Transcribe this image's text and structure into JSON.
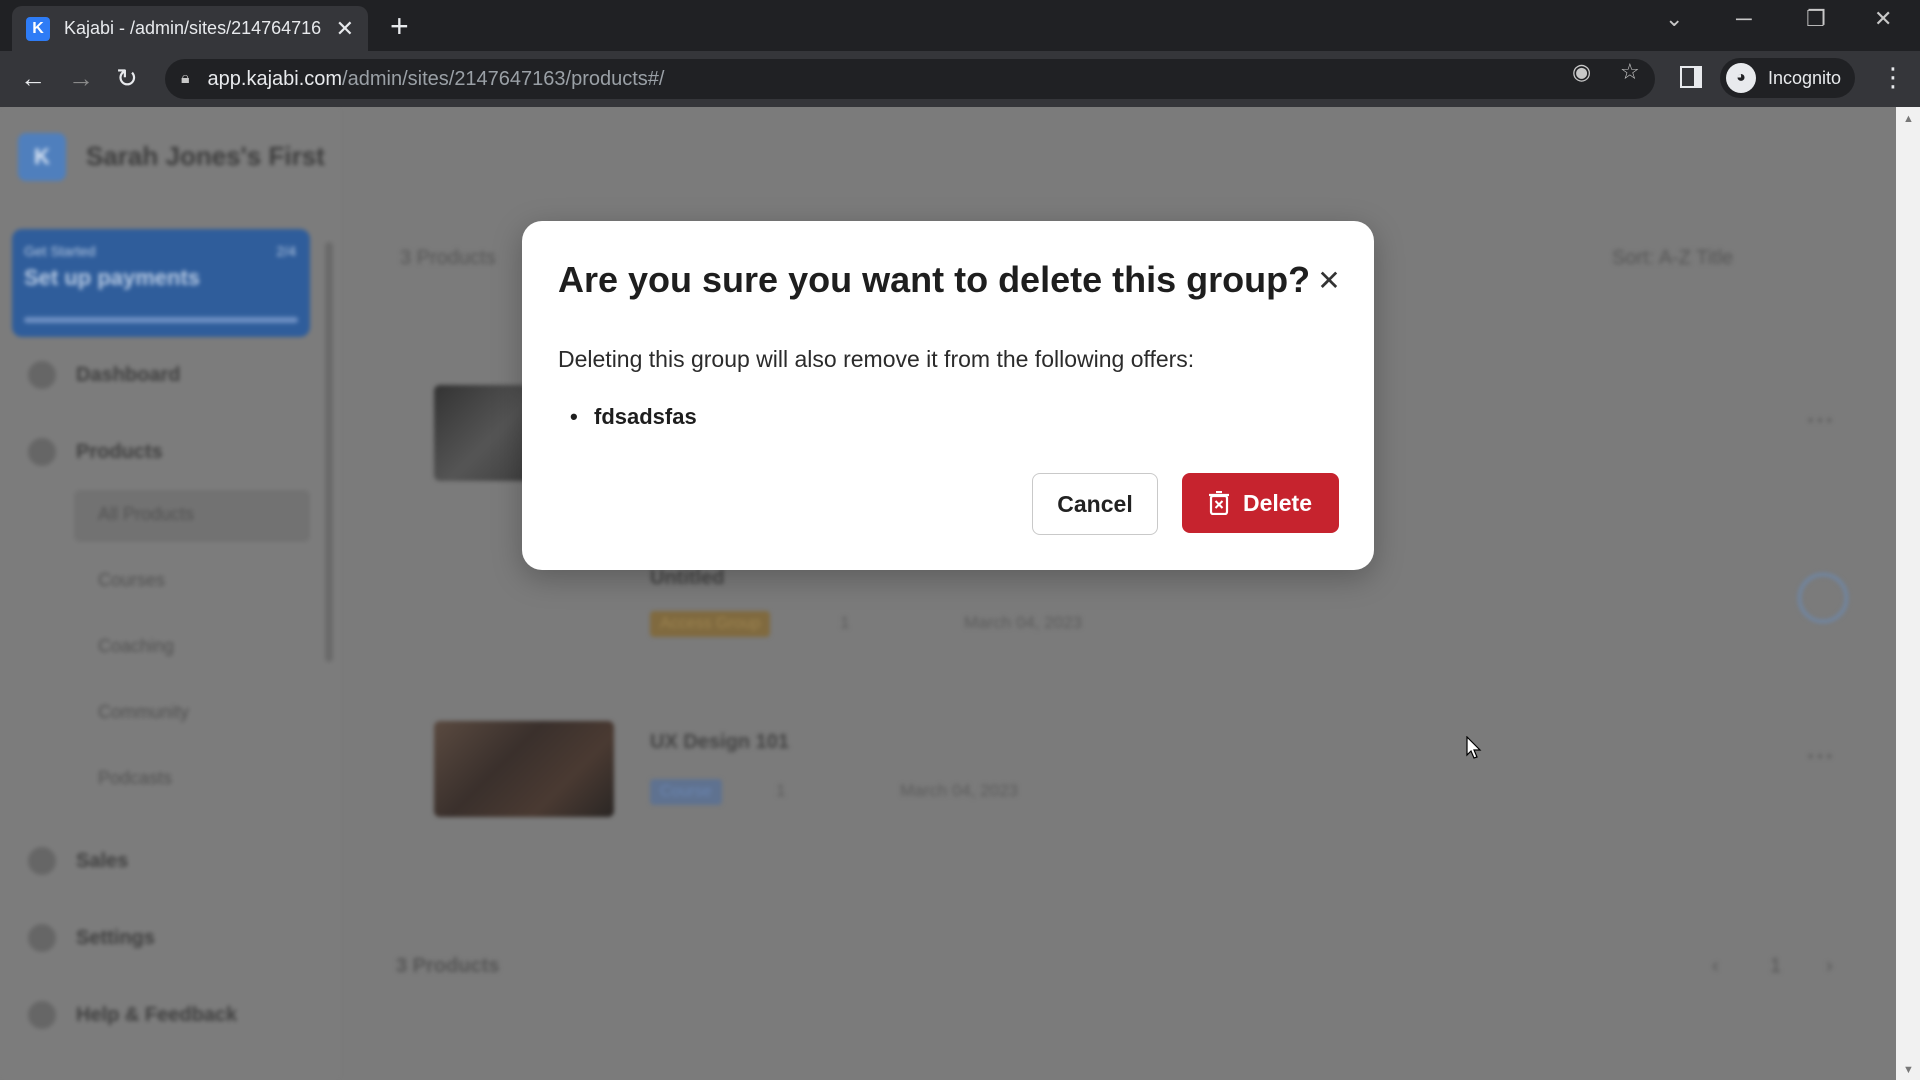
{
  "browser": {
    "tab_title": "Kajabi - /admin/sites/214764716",
    "favicon_letter": "K",
    "url_host": "app.kajabi.com",
    "url_path": "/admin/sites/2147647163/products#/",
    "profile_label": "Incognito"
  },
  "sidebar": {
    "logo_letter": "K",
    "site_name": "Sarah Jones's First",
    "promo": {
      "kicker": "Get Started",
      "title": "Set up payments",
      "count": "2/4"
    },
    "items": [
      {
        "label": "Dashboard"
      },
      {
        "label": "Products"
      },
      {
        "label": "Sales"
      },
      {
        "label": "Settings"
      },
      {
        "label": "Help & Feedback"
      }
    ],
    "sub_items": [
      {
        "label": "All Products"
      },
      {
        "label": "Courses"
      },
      {
        "label": "Coaching"
      },
      {
        "label": "Community"
      },
      {
        "label": "Podcasts"
      }
    ]
  },
  "main": {
    "list_header": "3 Products",
    "sort_label": "Sort: A-Z Title",
    "products": [
      {
        "title": "",
        "badge": "",
        "members": "",
        "date": ""
      },
      {
        "title": "Untitled",
        "badge": "Access Group",
        "members": "1",
        "date": "March 04, 2023"
      },
      {
        "title": "UX Design 101",
        "badge": "Course",
        "members": "1",
        "date": "March 04, 2023"
      }
    ],
    "footer_count": "3 Products",
    "page_number": "1"
  },
  "modal": {
    "title": "Are you sure you want to delete this group?",
    "body": "Deleting this group will also remove it from the following offers:",
    "offers": [
      "fdsadsfas"
    ],
    "cancel_label": "Cancel",
    "delete_label": "Delete"
  },
  "colors": {
    "delete_button": "#c6232e",
    "overlay": "#7b7b7b",
    "brand": "#2e7cf6"
  }
}
